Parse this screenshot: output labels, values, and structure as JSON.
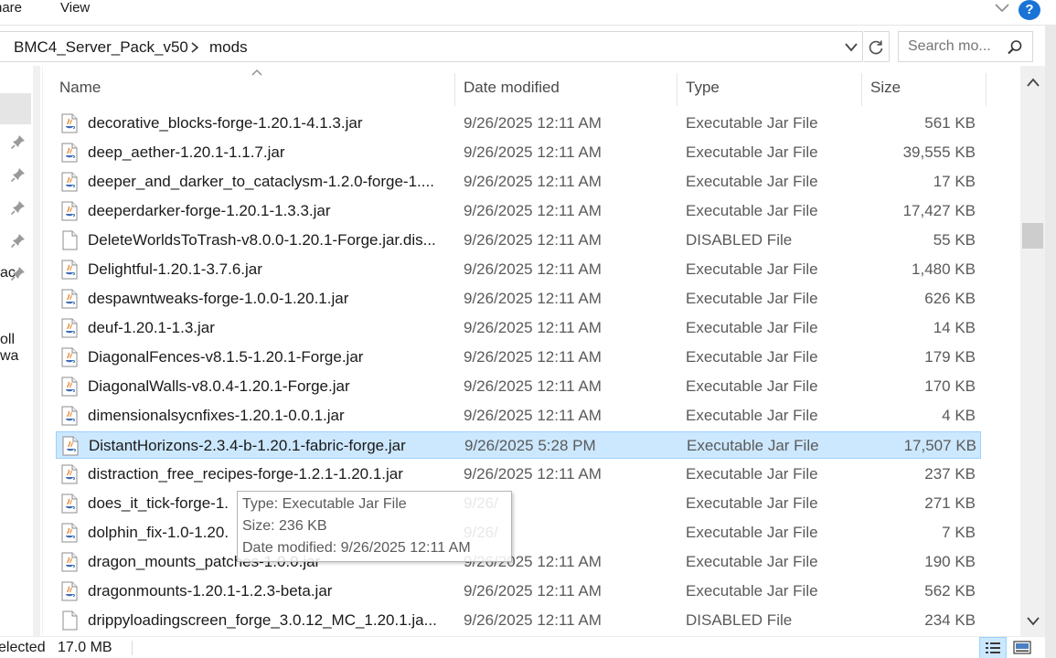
{
  "ribbon": {
    "tabs": [
      "hare",
      "View"
    ]
  },
  "address": {
    "crumbs": [
      "BMC4_Server_Pack_v50",
      "mods"
    ]
  },
  "search": {
    "placeholder": "Search mo..."
  },
  "nav": {
    "fragments": [
      "ac",
      "oll wa"
    ]
  },
  "columns": {
    "name": "Name",
    "date": "Date modified",
    "type": "Type",
    "size": "Size"
  },
  "files": [
    {
      "name": "decorative_blocks-forge-1.20.1-4.1.3.jar",
      "date": "9/26/2025 12:11 AM",
      "type": "Executable Jar File",
      "size": "561 KB",
      "icon": "java-jar-icon"
    },
    {
      "name": "deep_aether-1.20.1-1.1.7.jar",
      "date": "9/26/2025 12:11 AM",
      "type": "Executable Jar File",
      "size": "39,555 KB",
      "icon": "java-jar-icon"
    },
    {
      "name": "deeper_and_darker_to_cataclysm-1.2.0-forge-1....",
      "date": "9/26/2025 12:11 AM",
      "type": "Executable Jar File",
      "size": "17 KB",
      "icon": "java-jar-icon"
    },
    {
      "name": "deeperdarker-forge-1.20.1-1.3.3.jar",
      "date": "9/26/2025 12:11 AM",
      "type": "Executable Jar File",
      "size": "17,427 KB",
      "icon": "java-jar-icon"
    },
    {
      "name": "DeleteWorldsToTrash-v8.0.0-1.20.1-Forge.jar.dis...",
      "date": "9/26/2025 12:11 AM",
      "type": "DISABLED File",
      "size": "55 KB",
      "icon": "blank-file-icon"
    },
    {
      "name": "Delightful-1.20.1-3.7.6.jar",
      "date": "9/26/2025 12:11 AM",
      "type": "Executable Jar File",
      "size": "1,480 KB",
      "icon": "java-jar-icon"
    },
    {
      "name": "despawntweaks-forge-1.0.0-1.20.1.jar",
      "date": "9/26/2025 12:11 AM",
      "type": "Executable Jar File",
      "size": "626 KB",
      "icon": "java-jar-icon"
    },
    {
      "name": "deuf-1.20.1-1.3.jar",
      "date": "9/26/2025 12:11 AM",
      "type": "Executable Jar File",
      "size": "14 KB",
      "icon": "java-jar-icon"
    },
    {
      "name": "DiagonalFences-v8.1.5-1.20.1-Forge.jar",
      "date": "9/26/2025 12:11 AM",
      "type": "Executable Jar File",
      "size": "179 KB",
      "icon": "java-jar-icon"
    },
    {
      "name": "DiagonalWalls-v8.0.4-1.20.1-Forge.jar",
      "date": "9/26/2025 12:11 AM",
      "type": "Executable Jar File",
      "size": "170 KB",
      "icon": "java-jar-icon"
    },
    {
      "name": "dimensionalsycnfixes-1.20.1-0.0.1.jar",
      "date": "9/26/2025 12:11 AM",
      "type": "Executable Jar File",
      "size": "4 KB",
      "icon": "java-jar-icon"
    },
    {
      "name": "DistantHorizons-2.3.4-b-1.20.1-fabric-forge.jar",
      "date": "9/26/2025 5:28 PM",
      "type": "Executable Jar File",
      "size": "17,507 KB",
      "icon": "java-jar-icon",
      "selected": true
    },
    {
      "name": "distraction_free_recipes-forge-1.2.1-1.20.1.jar",
      "date": "9/26/2025 12:11 AM",
      "type": "Executable Jar File",
      "size": "237 KB",
      "icon": "java-jar-icon"
    },
    {
      "name": "does_it_tick-forge-1.",
      "date": "9/26/",
      "type": "Executable Jar File",
      "size": "271 KB",
      "icon": "java-jar-icon"
    },
    {
      "name": "dolphin_fix-1.0-1.20.",
      "date": "9/26/",
      "type": "Executable Jar File",
      "size": "7 KB",
      "icon": "java-jar-icon"
    },
    {
      "name": "dragon_mounts_patches-1.0.0.jar",
      "date": "9/26/2025 12:11 AM",
      "type": "Executable Jar File",
      "size": "190 KB",
      "icon": "java-jar-icon"
    },
    {
      "name": "dragonmounts-1.20.1-1.2.3-beta.jar",
      "date": "9/26/2025 12:11 AM",
      "type": "Executable Jar File",
      "size": "562 KB",
      "icon": "java-jar-icon"
    },
    {
      "name": "drippyloadingscreen_forge_3.0.12_MC_1.20.1.ja...",
      "date": "9/26/2025 12:11 AM",
      "type": "DISABLED File",
      "size": "234 KB",
      "icon": "blank-file-icon"
    }
  ],
  "tooltip": {
    "lines": [
      "Type: Executable Jar File",
      "Size: 236 KB",
      "Date modified: 9/26/2025 12:11 AM"
    ]
  },
  "status": {
    "selected_text": "elected",
    "size_text": "17.0 MB"
  },
  "colors": {
    "selection_bg": "#cce8ff",
    "selection_border": "#99d1ff",
    "help_blue": "#1a73d6"
  }
}
